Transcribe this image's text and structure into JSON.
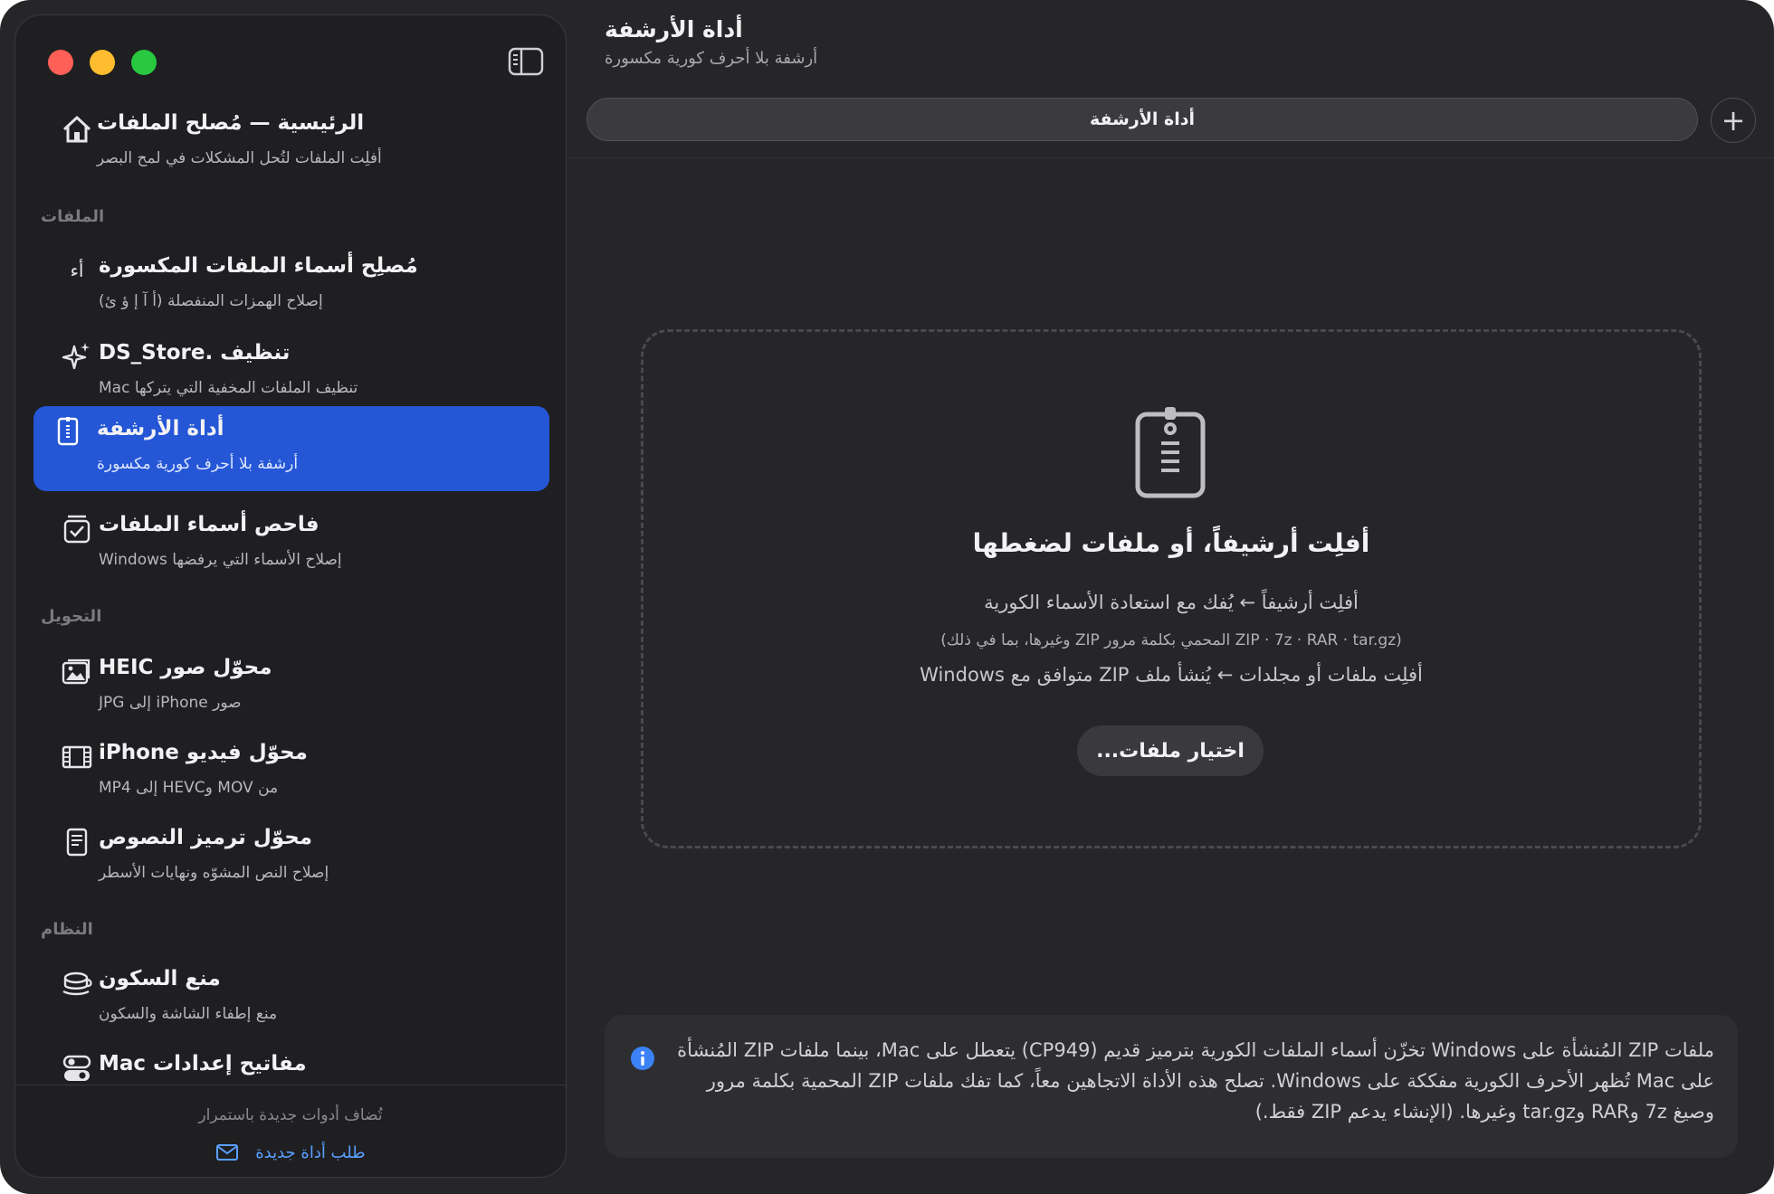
{
  "colors": {
    "accent": "#2456d6",
    "link": "#5aa0ff",
    "info": "#3b82f6"
  },
  "sidebar": {
    "home": {
      "title": "الرئيسية — مُصلح الملفات",
      "subtitle": "أفلِت الملفات لتُحل المشكلات في لمح البصر",
      "icon": "house-icon"
    },
    "sections": {
      "files": "الملفات",
      "conversion": "التحويل",
      "system": "النظام"
    },
    "items": [
      {
        "title": "مُصلِح أسماء الملفات المكسورة",
        "subtitle": "إصلاح الهمزات المنفصلة (أ آ إ ؤ ئ)",
        "icon": "text-glyph-icon",
        "glyph": "أء"
      },
      {
        "title": "تنظيف .DS_Store",
        "subtitle": "تنظيف الملفات المخفية التي يتركها Mac",
        "icon": "sparkles-icon"
      },
      {
        "title": "أداة الأرشفة",
        "subtitle": "أرشفة بلا أحرف كورية مكسورة",
        "icon": "zip-file-icon",
        "selected": true
      },
      {
        "title": "فاحص أسماء الملفات",
        "subtitle": "إصلاح الأسماء التي يرفضها Windows",
        "icon": "checkbox-tray-icon"
      },
      {
        "title": "محوّل صور HEIC",
        "subtitle": "صور iPhone إلى JPG",
        "icon": "photos-icon"
      },
      {
        "title": "محوّل فيديو iPhone",
        "subtitle": "من MOV وHEVC إلى MP4",
        "icon": "film-icon"
      },
      {
        "title": "محوّل ترميز النصوص",
        "subtitle": "إصلاح النص المشوّه ونهايات الأسطر",
        "icon": "document-icon"
      },
      {
        "title": "منع السكون",
        "subtitle": "منع إطفاء الشاشة والسكون",
        "icon": "coffee-cup-icon"
      },
      {
        "title": "مفاتيح إعدادات Mac",
        "subtitle": "",
        "icon": "toggles-icon"
      }
    ],
    "footer": {
      "note": "تُضاف أدوات جديدة باستمرار",
      "link": "طلب أداة جديدة"
    }
  },
  "main": {
    "title": "أداة الأرشفة",
    "subtitle": "أرشفة بلا أحرف كورية مكسورة",
    "tab": "أداة الأرشفة",
    "add_tab": "+",
    "dropzone": {
      "title": "أفلِت أرشيفاً، أو ملفات لضغطها",
      "line1": "أفلِت أرشيفاً ← يُفك مع استعادة الأسماء الكورية",
      "line2": "(ZIP · 7z · RAR · tar.gz المحمي بكلمة مرور ZIP وغيرها، بما في ذلك)",
      "line3": "أفلِت ملفات أو مجلدات ← يُنشأ ملف ZIP متوافق مع Windows",
      "button": "اختيار ملفات..."
    },
    "info": "ملفات ZIP المُنشأة على Windows تخزّن أسماء الملفات الكورية بترميز قديم (CP949) يتعطل على Mac، بينما ملفات ZIP المُنشأة على Mac تُظهر الأحرف الكورية مفككة على Windows. تصلح هذه الأداة الاتجاهين معاً، كما تفك ملفات ZIP المحمية بكلمة مرور وصيغ 7z وRAR وtar.gz وغيرها. (الإنشاء يدعم ZIP فقط.)"
  }
}
